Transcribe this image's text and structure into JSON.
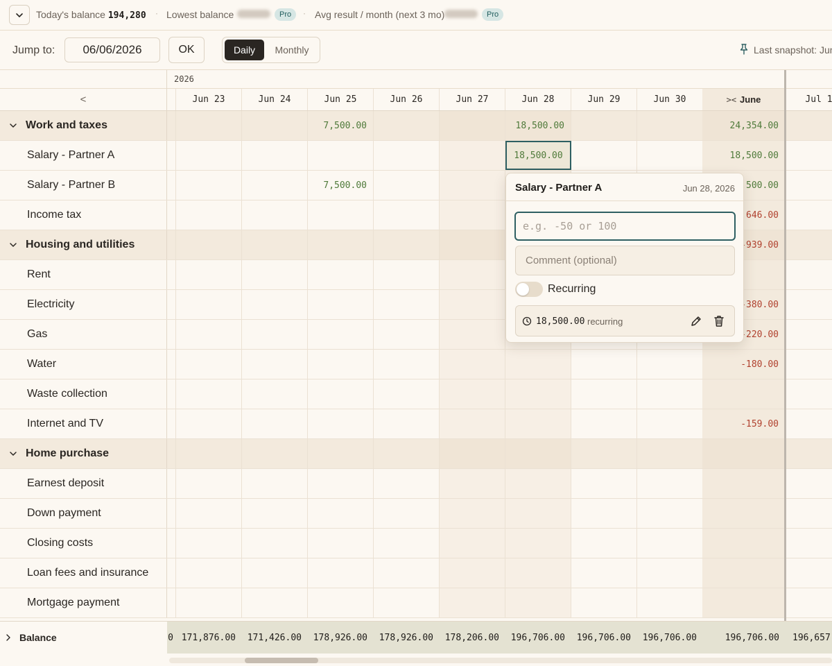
{
  "stats": {
    "today_label": "Today's balance",
    "today_value": "194,280",
    "lowest_label": "Lowest balance",
    "pro_badge": "Pro",
    "avg_label": "Avg result / month (next 3 mo)"
  },
  "toolbar": {
    "jump_label": "Jump to:",
    "jump_date": "06/06/2026",
    "ok_label": "OK",
    "view_daily": "Daily",
    "view_monthly": "Monthly",
    "snapshot_label": "Last snapshot: Jun"
  },
  "grid": {
    "year": "2026",
    "prev_arrow": "<",
    "days": [
      "Jun 23",
      "Jun 24",
      "Jun 25",
      "Jun 26",
      "Jun 27",
      "Jun 28",
      "Jun 29",
      "Jun 30"
    ],
    "month_summary_label": "June",
    "month_collapse_icon": "><",
    "next_month_label": "Jul 1",
    "rows": [
      {
        "type": "group",
        "label": "Work and taxes",
        "cells": {
          "Jun 25": "7,500.00",
          "Jun 28": "18,500.00"
        },
        "month": "24,354.00",
        "month_sign": "pos"
      },
      {
        "type": "item",
        "label": "Salary - Partner A",
        "cells": {
          "Jun 28": "18,500.00"
        },
        "month": "18,500.00",
        "month_sign": "pos"
      },
      {
        "type": "item",
        "label": "Salary - Partner B",
        "cells": {
          "Jun 25": "7,500.00"
        },
        "month": ",500.00",
        "month_sign": "pos"
      },
      {
        "type": "item",
        "label": "Income tax",
        "cells": {},
        "month": ",646.00",
        "month_sign": "neg"
      },
      {
        "type": "group",
        "label": "Housing and utilities",
        "cells": {},
        "month": "-939.00",
        "month_sign": "neg"
      },
      {
        "type": "item",
        "label": "Rent",
        "cells": {},
        "month": "",
        "month_sign": "neg"
      },
      {
        "type": "item",
        "label": "Electricity",
        "cells": {},
        "month": "-380.00",
        "month_sign": "neg"
      },
      {
        "type": "item",
        "label": "Gas",
        "cells": {},
        "month": "-220.00",
        "month_sign": "neg"
      },
      {
        "type": "item",
        "label": "Water",
        "cells": {},
        "month": "-180.00",
        "month_sign": "neg"
      },
      {
        "type": "item",
        "label": "Waste collection",
        "cells": {},
        "month": "",
        "month_sign": "neg"
      },
      {
        "type": "item",
        "label": "Internet and TV",
        "cells": {},
        "month": "-159.00",
        "month_sign": "neg"
      },
      {
        "type": "group",
        "label": "Home purchase",
        "cells": {},
        "month": "",
        "month_sign": "neg"
      },
      {
        "type": "item",
        "label": "Earnest deposit",
        "cells": {},
        "month": "",
        "month_sign": "neg"
      },
      {
        "type": "item",
        "label": "Down payment",
        "cells": {},
        "month": "",
        "month_sign": "neg"
      },
      {
        "type": "item",
        "label": "Closing costs",
        "cells": {},
        "month": "",
        "month_sign": "neg"
      },
      {
        "type": "item",
        "label": "Loan fees and insurance",
        "cells": {},
        "month": "",
        "month_sign": "neg"
      },
      {
        "type": "item",
        "label": "Mortgage payment",
        "cells": {},
        "month": "",
        "month_sign": "neg"
      }
    ],
    "balance": {
      "label": "Balance",
      "partial": "0",
      "values": [
        "171,876.00",
        "171,426.00",
        "178,926.00",
        "178,926.00",
        "178,206.00",
        "196,706.00",
        "196,706.00",
        "196,706.00"
      ],
      "month_value": "196,706.00",
      "next_value": "196,657."
    }
  },
  "popover": {
    "title": "Salary - Partner A",
    "date": "Jun 28, 2026",
    "amount_placeholder": "e.g. -50 or 100",
    "comment_placeholder": "Comment (optional)",
    "recurring_label": "Recurring",
    "entry_amount": "18,500.00",
    "entry_suffix": "recurring"
  },
  "colors": {
    "accent": "#2e5f62",
    "positive": "#4f7a3a",
    "negative": "#b0412e",
    "active_tab": "#2a2622",
    "group_bg": "#f3eadd"
  }
}
